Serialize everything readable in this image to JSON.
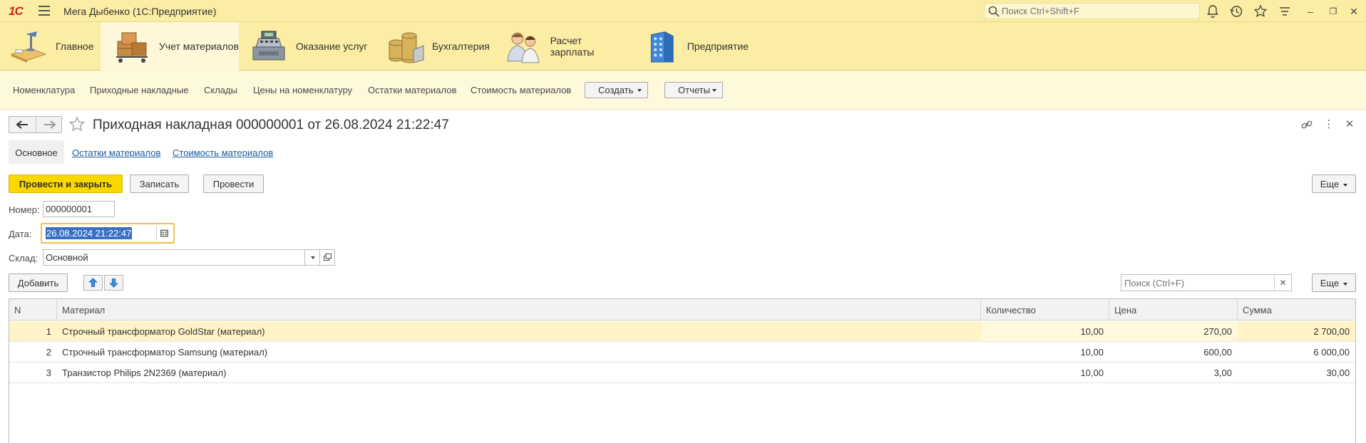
{
  "titlebar": {
    "logo": "1С",
    "app_title": "Мега Дыбенко  (1С:Предприятие)",
    "search_placeholder": "Поиск Ctrl+Shift+F"
  },
  "sections": [
    {
      "label": "Главное",
      "icon": "home-desk-icon"
    },
    {
      "label": "Учет материалов",
      "icon": "boxes-cart-icon"
    },
    {
      "label": "Оказание услуг",
      "icon": "cash-register-icon"
    },
    {
      "label": "Бухгалтерия",
      "icon": "coins-icon"
    },
    {
      "label": "Расчет зарплаты",
      "icon": "people-icon"
    },
    {
      "label": "Предприятие",
      "icon": "building-icon"
    }
  ],
  "function_panel": {
    "links": [
      "Номенклатура",
      "Приходные накладные",
      "Склады",
      "Цены на номенклатуру",
      "Остатки материалов",
      "Стоимость материалов"
    ],
    "create_label": "Создать",
    "reports_label": "Отчеты"
  },
  "form": {
    "title": "Приходная накладная 000000001 от 26.08.2024 21:22:47",
    "tabs": {
      "main": "Основное",
      "balances": "Остатки материалов",
      "cost": "Стоимость материалов"
    },
    "buttons": {
      "post_close": "Провести и закрыть",
      "write": "Записать",
      "post": "Провести",
      "more": "Еще",
      "add": "Добавить",
      "more_table": "Еще"
    },
    "fields": {
      "number_label": "Номер:",
      "number_value": "000000001",
      "date_label": "Дата:",
      "date_value": "26.08.2024 21:22:47",
      "warehouse_label": "Склад:",
      "warehouse_value": "Основной"
    },
    "table_search_placeholder": "Поиск (Ctrl+F)"
  },
  "table": {
    "columns": [
      "N",
      "Материал",
      "Количество",
      "Цена",
      "Сумма"
    ],
    "rows": [
      {
        "n": "1",
        "material": "Строчный трансформатор GoldStar (материал)",
        "qty": "10,00",
        "price": "270,00",
        "sum": "2 700,00"
      },
      {
        "n": "2",
        "material": "Строчный трансформатор Samsung (материал)",
        "qty": "10,00",
        "price": "600,00",
        "sum": "6 000,00"
      },
      {
        "n": "3",
        "material": "Транзистор Philips 2N2369 (материал)",
        "qty": "10,00",
        "price": "3,00",
        "sum": "30,00"
      }
    ]
  },
  "colors": {
    "accent_yellow": "#fbd700",
    "panel_yellow": "#fbeda3",
    "link_blue": "#1a5aa0",
    "selection_blue": "#3a6fc6"
  }
}
